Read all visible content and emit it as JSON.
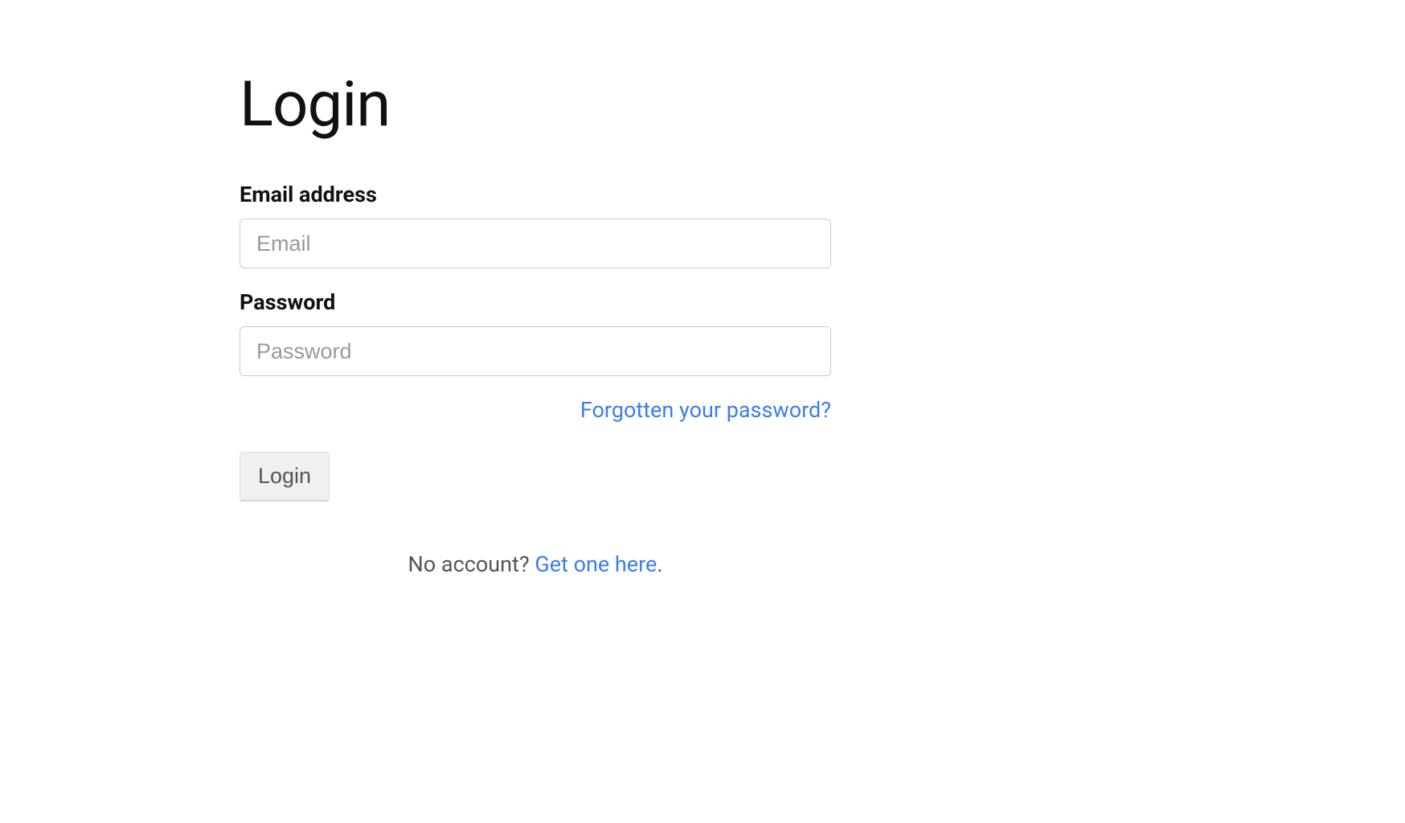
{
  "page": {
    "title": "Login"
  },
  "form": {
    "email": {
      "label": "Email address",
      "placeholder": "Email",
      "value": ""
    },
    "password": {
      "label": "Password",
      "placeholder": "Password",
      "value": ""
    },
    "forgot_link": "Forgotten your password?",
    "submit_label": "Login"
  },
  "footer": {
    "prefix": "No account? ",
    "link_text": "Get one here",
    "suffix": "."
  }
}
